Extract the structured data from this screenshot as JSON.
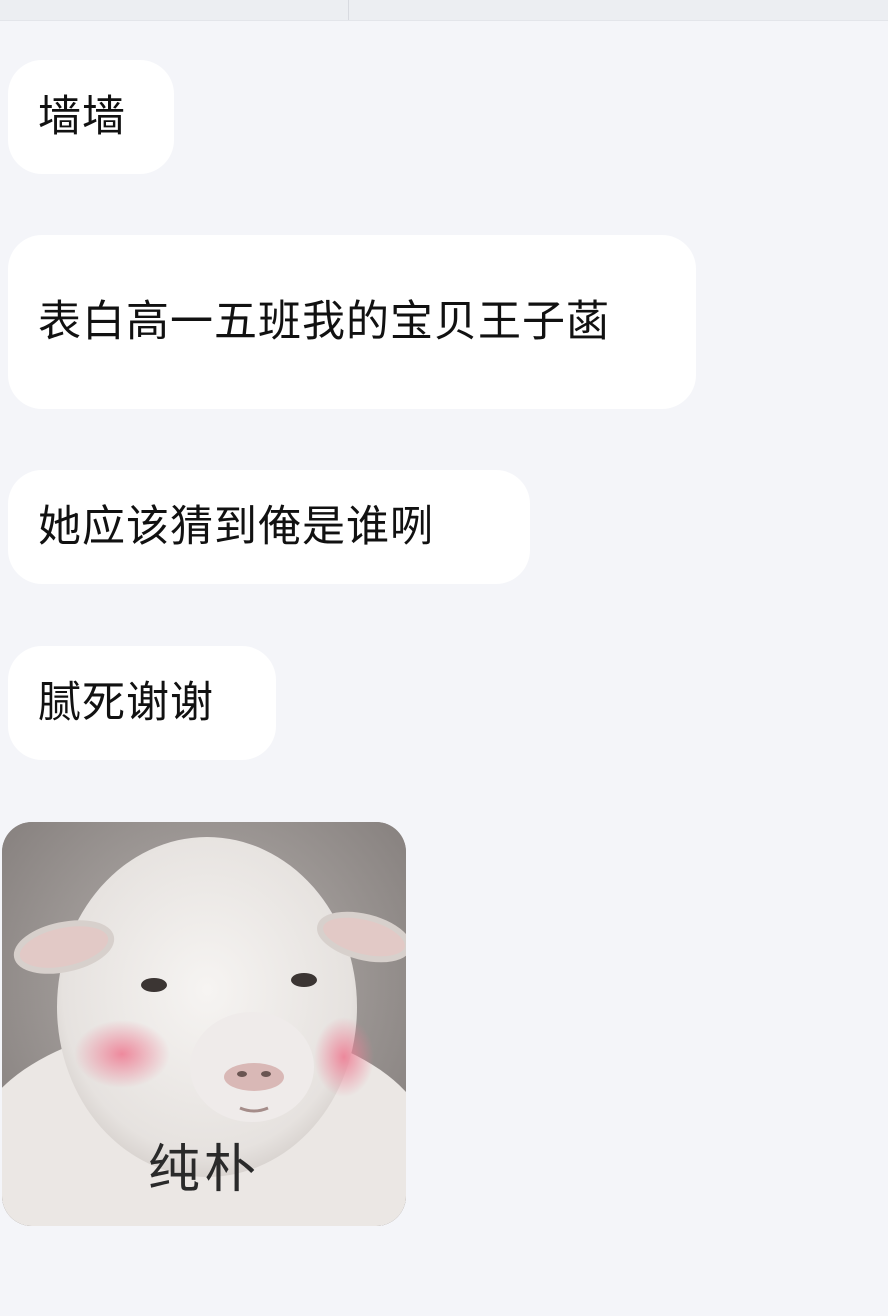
{
  "messages": [
    {
      "text": "墙墙"
    },
    {
      "text": "表白高一五班我的宝贝王子菡"
    },
    {
      "text": "她应该猜到俺是谁咧"
    },
    {
      "text": "腻死谢谢"
    }
  ],
  "sticker": {
    "caption": "纯朴",
    "subject": "sheep-meme-sticker"
  },
  "colors": {
    "background": "#f4f5f9",
    "bubble": "#ffffff",
    "text": "#111111"
  }
}
